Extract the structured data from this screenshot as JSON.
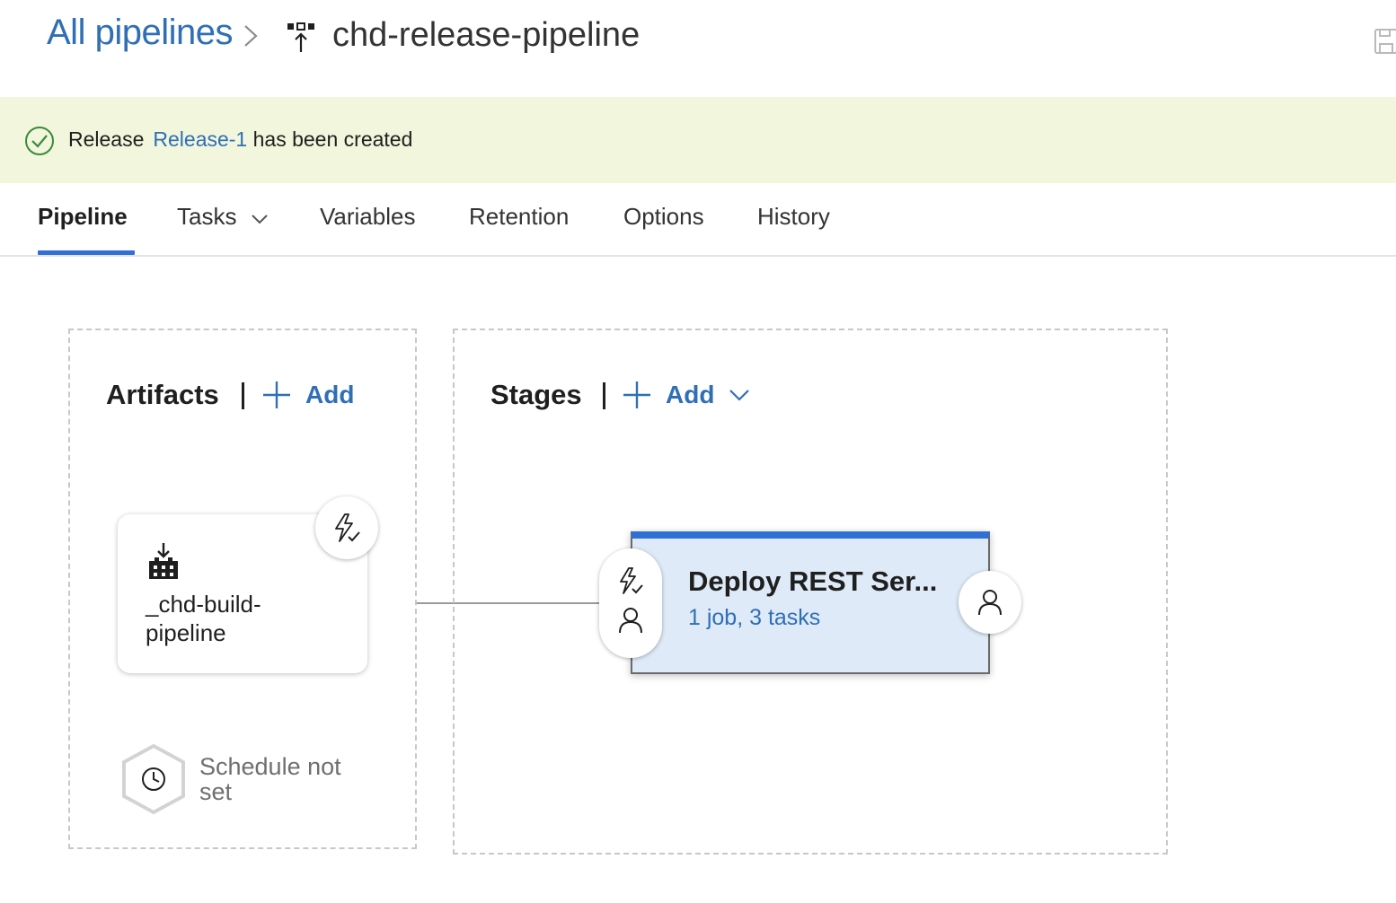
{
  "header": {
    "breadcrumb_root": "All pipelines",
    "pipeline_name": "chd-release-pipeline",
    "icons": [
      "chevron-right-icon",
      "release-pipeline-icon",
      "save-icon"
    ]
  },
  "banner": {
    "prefix": "Release",
    "release_link": "Release-1",
    "suffix": "has been created",
    "icon": "success-check-icon",
    "background_color": "#f1f6dc"
  },
  "tabs": [
    {
      "label": "Pipeline",
      "active": true
    },
    {
      "label": "Tasks",
      "has_dropdown": true
    },
    {
      "label": "Variables"
    },
    {
      "label": "Retention"
    },
    {
      "label": "Options"
    },
    {
      "label": "History"
    }
  ],
  "artifacts": {
    "heading": "Artifacts",
    "add_label": "Add",
    "card": {
      "name": "_chd-build-pipeline",
      "icon": "build-artifact-icon",
      "trigger_icon": "continuous-deployment-trigger-icon"
    },
    "schedule": {
      "text": "Schedule not set",
      "icon": "clock-icon"
    }
  },
  "stages": {
    "heading": "Stages",
    "add_label": "Add",
    "card": {
      "name": "Deploy REST Ser...",
      "summary": "1 job, 3 tasks",
      "pre_icons": [
        "lightning-trigger-icon",
        "pre-approver-icon"
      ],
      "post_icon": "post-approver-icon"
    }
  },
  "colors": {
    "accent": "#2f6fd6",
    "link": "#2f6fb5",
    "stage_fill": "#deeaf7"
  }
}
